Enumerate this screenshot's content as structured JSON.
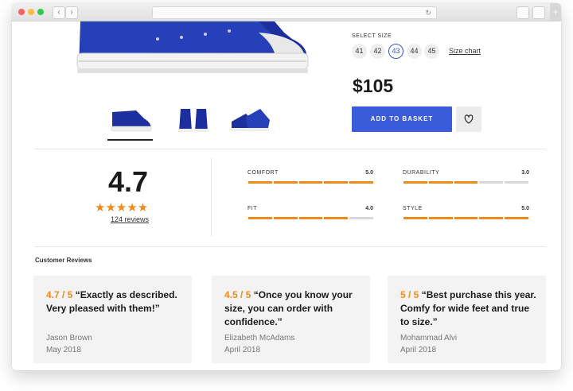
{
  "product": {
    "size_label": "SELECT SIZE",
    "sizes": [
      "41",
      "42",
      "43",
      "44",
      "45"
    ],
    "selected_size": "43",
    "size_chart_link": "Size chart",
    "price": "$105",
    "add_to_basket_label": "ADD TO BASKET"
  },
  "rating_summary": {
    "score": "4.7",
    "stars": "★★★★★",
    "review_count": "124 reviews"
  },
  "metrics": [
    {
      "label": "COMFORT",
      "value": "5.0",
      "score": 5
    },
    {
      "label": "DURABILITY",
      "value": "3.0",
      "score": 3
    },
    {
      "label": "FIT",
      "value": "4.0",
      "score": 4
    },
    {
      "label": "STYLE",
      "value": "5.0",
      "score": 5
    }
  ],
  "reviews_title": "Customer Reviews",
  "reviews": [
    {
      "score": "4.7 / 5",
      "text": "“Exactly as described. Very pleased with them!”",
      "author": "Jason Brown",
      "date": "May 2018"
    },
    {
      "score": "4.5 / 5",
      "text": "“Once you know your size, you can order with confidence.”",
      "author": "Elizabeth McAdams",
      "date": "April 2018"
    },
    {
      "score": "5 / 5",
      "text": "“Best purchase this year. Comfy for wide feet and true to size.”",
      "author": "Mohammad Alvi",
      "date": "April 2018"
    }
  ],
  "colors": {
    "accent": "#3a5cd8",
    "rating": "#f08a1c"
  },
  "icons": [
    "back-icon",
    "forward-icon",
    "reload-icon",
    "share-icon",
    "tabs-icon",
    "heart-icon",
    "star-icon"
  ]
}
